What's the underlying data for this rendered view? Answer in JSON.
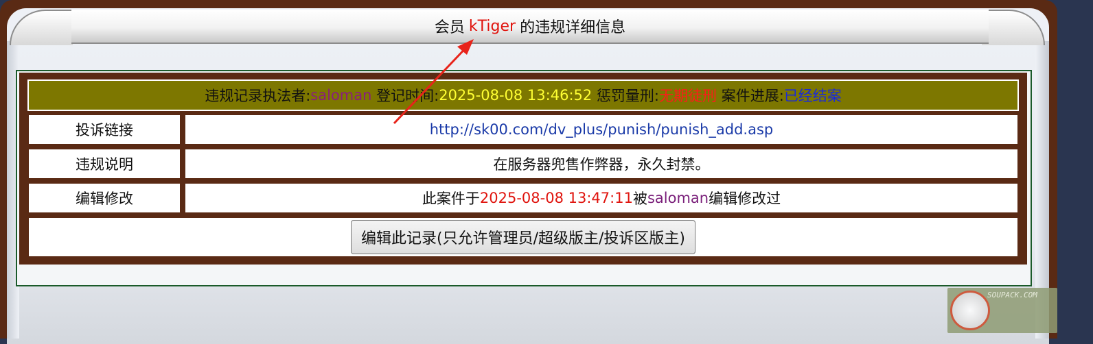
{
  "header": {
    "prefix": "会员",
    "member": "kTiger",
    "suffix": "的违规详细信息"
  },
  "info": {
    "enforcer_label": "违规记录执法者:",
    "enforcer": "saloman",
    "time_label": "登记时间:",
    "time": "2025-08-08 13:46:52",
    "penalty_label": "惩罚量刑:",
    "penalty": "无期徒刑",
    "progress_label": "案件进展:",
    "progress": "已经结案"
  },
  "rows": {
    "complaint_label": "投诉链接",
    "complaint_link": "http://sk00.com/dv_plus/punish/punish_add.asp",
    "reason_label": "违规说明",
    "reason": "在服务器兜售作弊器，永久封禁。",
    "edit_label": "编辑修改",
    "edit_prefix": "此案件于",
    "edit_time": "2025-08-08 13:47:11",
    "edit_by": "被",
    "edit_user": "saloman",
    "edit_suffix": "编辑修改过"
  },
  "action": {
    "edit_button": "编辑此记录(只允许管理员/超级版主/投诉区版主)"
  },
  "watermark": {
    "text": "SOUPACK.COM"
  },
  "colors": {
    "frame": "#5a2a14",
    "info_bar": "#7d7700",
    "member": "#e0140e",
    "arrow": "#e8231a"
  }
}
